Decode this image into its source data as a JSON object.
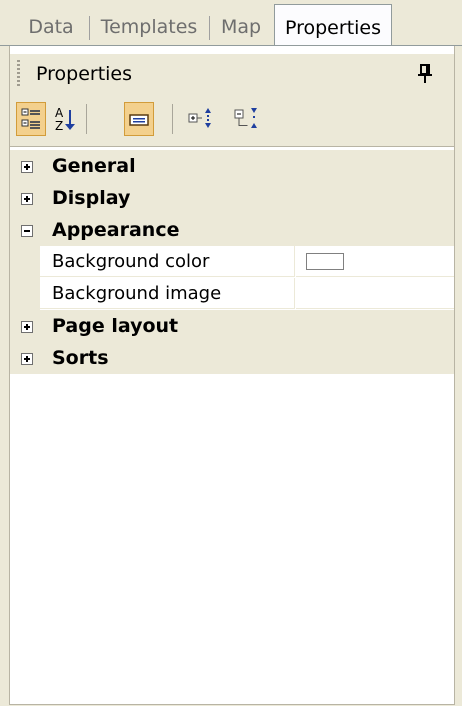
{
  "tabs": [
    {
      "label": "Data",
      "active": false
    },
    {
      "label": "Templates",
      "active": false
    },
    {
      "label": "Map",
      "active": false
    },
    {
      "label": "Properties",
      "active": true
    }
  ],
  "panel": {
    "title": "Properties",
    "pin_icon": "pin-icon"
  },
  "toolbar": {
    "buttons": [
      {
        "icon": "categorized-view-icon",
        "checked": true
      },
      {
        "icon": "alphabetical-sort-icon",
        "checked": false
      },
      {
        "icon": "property-pages-icon",
        "checked": true
      },
      {
        "icon": "expand-all-icon",
        "checked": false
      },
      {
        "icon": "collapse-all-icon",
        "checked": false
      }
    ]
  },
  "grid": {
    "categories": [
      {
        "label": "General",
        "expanded": false
      },
      {
        "label": "Display",
        "expanded": false
      },
      {
        "label": "Appearance",
        "expanded": true,
        "properties": [
          {
            "name": "Background color",
            "value": "",
            "swatch": "#FFFFFF"
          },
          {
            "name": "Background image",
            "value": ""
          }
        ]
      },
      {
        "label": "Page layout",
        "expanded": false
      },
      {
        "label": "Sorts",
        "expanded": false
      }
    ]
  },
  "colors": {
    "chrome": "#ECE9D8",
    "checked_button": "#F3D08D",
    "border": "#919B9C"
  }
}
